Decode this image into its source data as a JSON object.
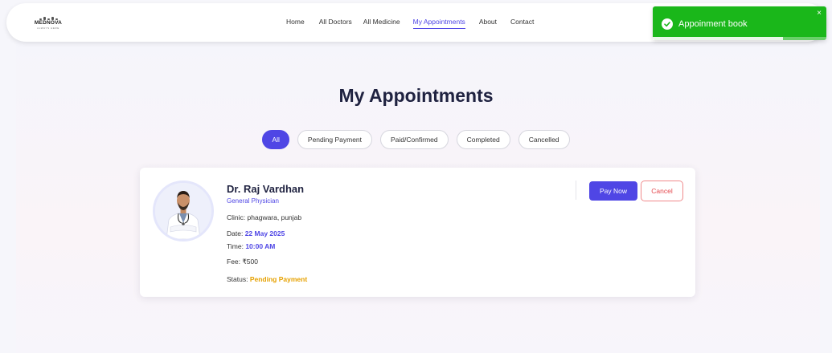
{
  "brand": {
    "name": "MEDNOVA",
    "tagline": "ALWAYS HERE"
  },
  "nav": {
    "items": [
      {
        "label": "Home",
        "active": false
      },
      {
        "label": "All Doctors",
        "active": false
      },
      {
        "label": "All Medicine",
        "active": false
      },
      {
        "label": "My Appointments",
        "active": true
      },
      {
        "label": "About",
        "active": false
      },
      {
        "label": "Contact",
        "active": false
      }
    ]
  },
  "toast": {
    "message": "Appoinment book",
    "close": "×",
    "progress": 0.75
  },
  "page": {
    "title": "My Appointments"
  },
  "filters": [
    {
      "label": "All",
      "active": true
    },
    {
      "label": "Pending Payment",
      "active": false
    },
    {
      "label": "Paid/Confirmed",
      "active": false
    },
    {
      "label": "Completed",
      "active": false
    },
    {
      "label": "Cancelled",
      "active": false
    }
  ],
  "appointment": {
    "doctor_name": "Dr. Raj Vardhan",
    "speciality": "General Physician",
    "clinic_label": "Clinic:",
    "clinic_value": "phagwara, punjab",
    "date_label": "Date:",
    "date_value": "22 May 2025",
    "time_label": "Time:",
    "time_value": "10:00 AM",
    "fee_label": "Fee:",
    "fee_value": "₹500",
    "status_label": "Status:",
    "status_value": "Pending Payment",
    "pay_label": "Pay Now",
    "cancel_label": "Cancel"
  },
  "colors": {
    "accent": "#4f46e5",
    "toast_green": "#1ab71a",
    "status_pending": "#e6a100",
    "cancel_red": "#e5484d"
  }
}
